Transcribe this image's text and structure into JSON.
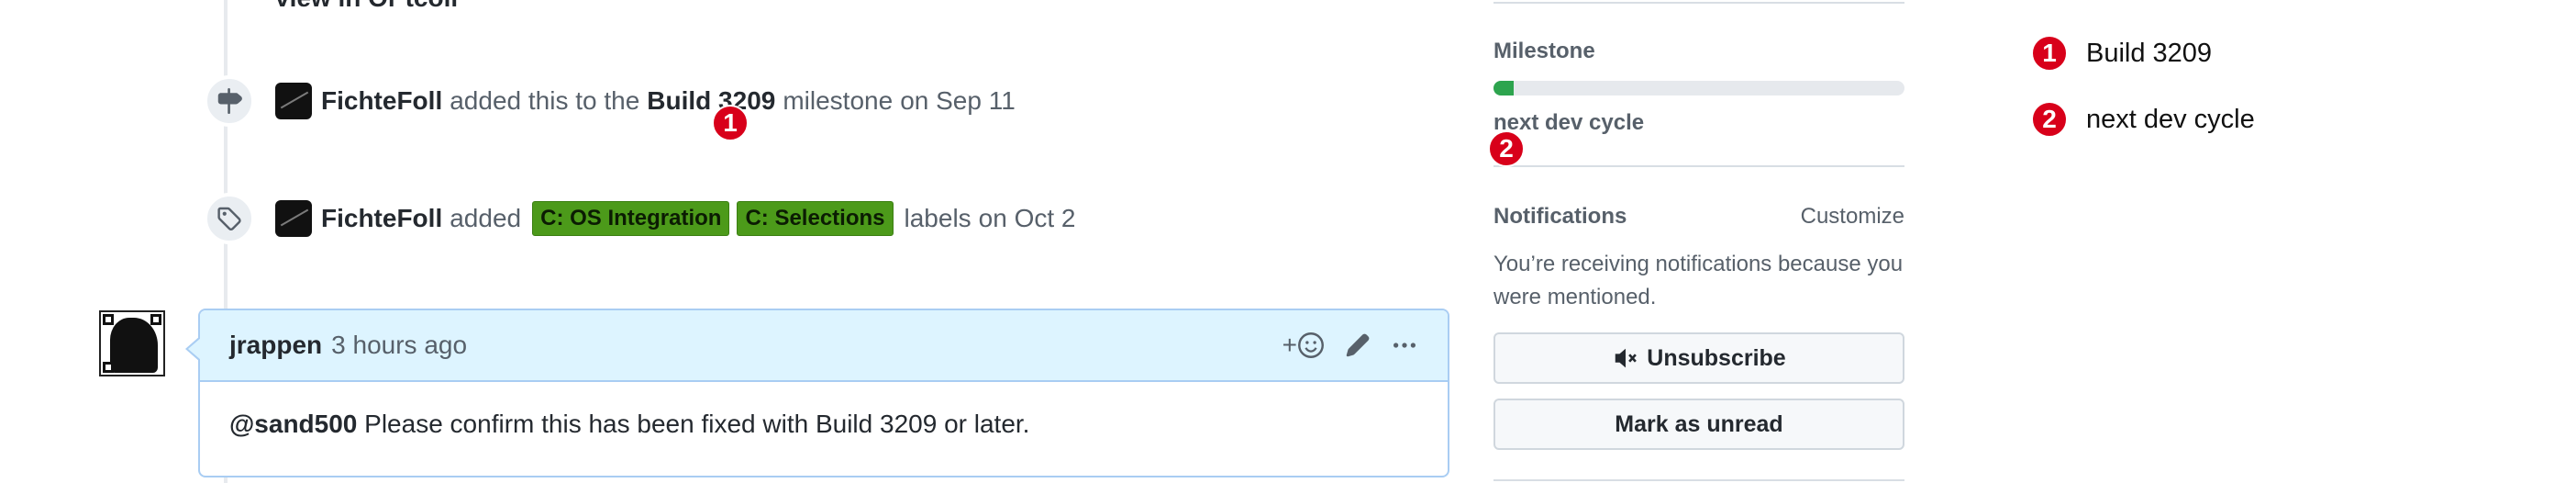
{
  "timeline": {
    "cut_text": "view in Or tcoll",
    "milestone_event": {
      "actor": "FichteFoll",
      "text_before": "added this to the",
      "milestone": "Build 3209",
      "text_after": "milestone",
      "when": "on Sep 11"
    },
    "labels_event": {
      "actor": "FichteFoll",
      "text_before": "added",
      "labels": [
        "C: OS Integration",
        "C: Selections"
      ],
      "text_after": "labels",
      "when": "on Oct 2"
    }
  },
  "comment": {
    "author": "jrappen",
    "time": "3 hours ago",
    "reaction_plus": "+",
    "mention": "@sand500",
    "body": "Please confirm this has been fixed with Build 3209 or later."
  },
  "sidebar": {
    "milestone": {
      "title": "Milestone",
      "progress_percent": 5,
      "name": "next dev cycle",
      "progress_color": "#2da44e"
    },
    "notifications": {
      "title": "Notifications",
      "customize": "Customize",
      "info": "You’re receiving notifications because you were mentioned.",
      "unsubscribe": "Unsubscribe",
      "mark_unread": "Mark as unread"
    }
  },
  "markers": [
    {
      "number": "1",
      "label": "Build 3209"
    },
    {
      "number": "2",
      "label": "next dev cycle"
    }
  ],
  "colors": {
    "marker": "#d8001a",
    "label_green": "#4c9a1a",
    "comment_header": "#ddf4ff"
  }
}
